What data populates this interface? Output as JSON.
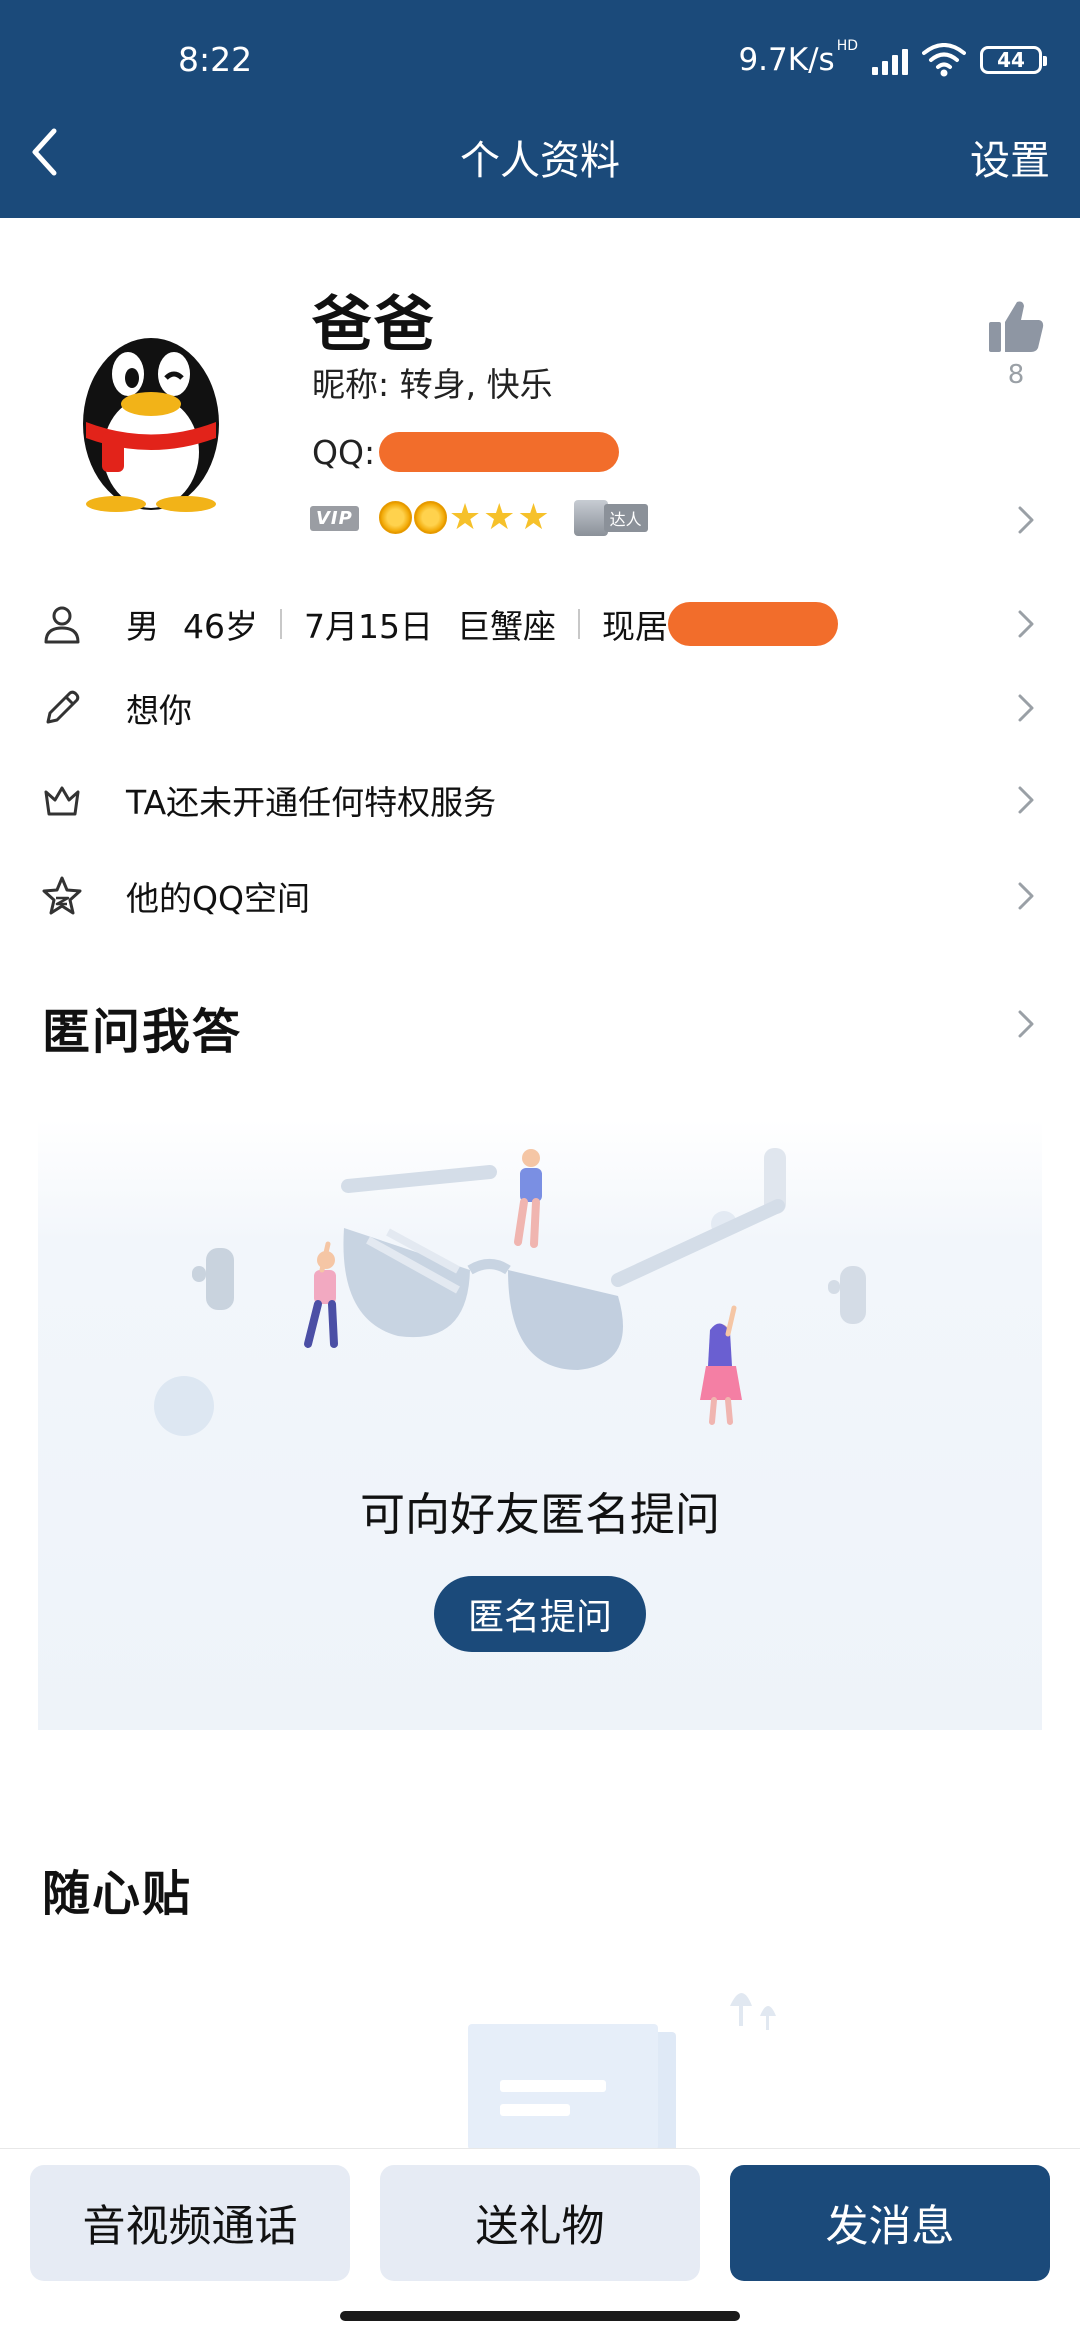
{
  "status_bar": {
    "time": "8:22",
    "network_speed": "9.7K/s",
    "network_type": "HD",
    "battery": "44"
  },
  "nav": {
    "back_icon": "chevron-left-icon",
    "title": "个人资料",
    "settings_label": "设置"
  },
  "profile": {
    "avatar": "qq-penguin-avatar",
    "name": "爸爸",
    "nickname": "昵称: 转身, 快乐",
    "qq_label": "QQ:",
    "vip_badge": "VIP",
    "level_icons": [
      "sun-icon",
      "sun-icon",
      "star-icon",
      "star-icon",
      "star-icon"
    ],
    "expert_badge": "达人",
    "likes": "8"
  },
  "info_rows": {
    "basic": {
      "icon": "person-icon",
      "gender": "男",
      "age": "46岁",
      "birthday": "7月15日",
      "zodiac": "巨蟹座",
      "residence_label": "现居"
    },
    "signature": {
      "icon": "pencil-icon",
      "text": "想你"
    },
    "privilege": {
      "icon": "crown-icon",
      "text": "TA还未开通任何特权服务"
    },
    "qzone": {
      "icon": "star-outline-icon",
      "text": "他的QQ空间"
    }
  },
  "anonymous_qa": {
    "title": "匿问我答",
    "caption": "可向好友匿名提问",
    "button": "匿名提问"
  },
  "sticky_notes": {
    "title": "随心贴"
  },
  "bottom_bar": {
    "call": "音视频通话",
    "gift": "送礼物",
    "message": "发消息"
  },
  "colors": {
    "brand": "#1b4a7a",
    "redaction": "#f26d2b",
    "light_button": "#e6ebf4"
  }
}
